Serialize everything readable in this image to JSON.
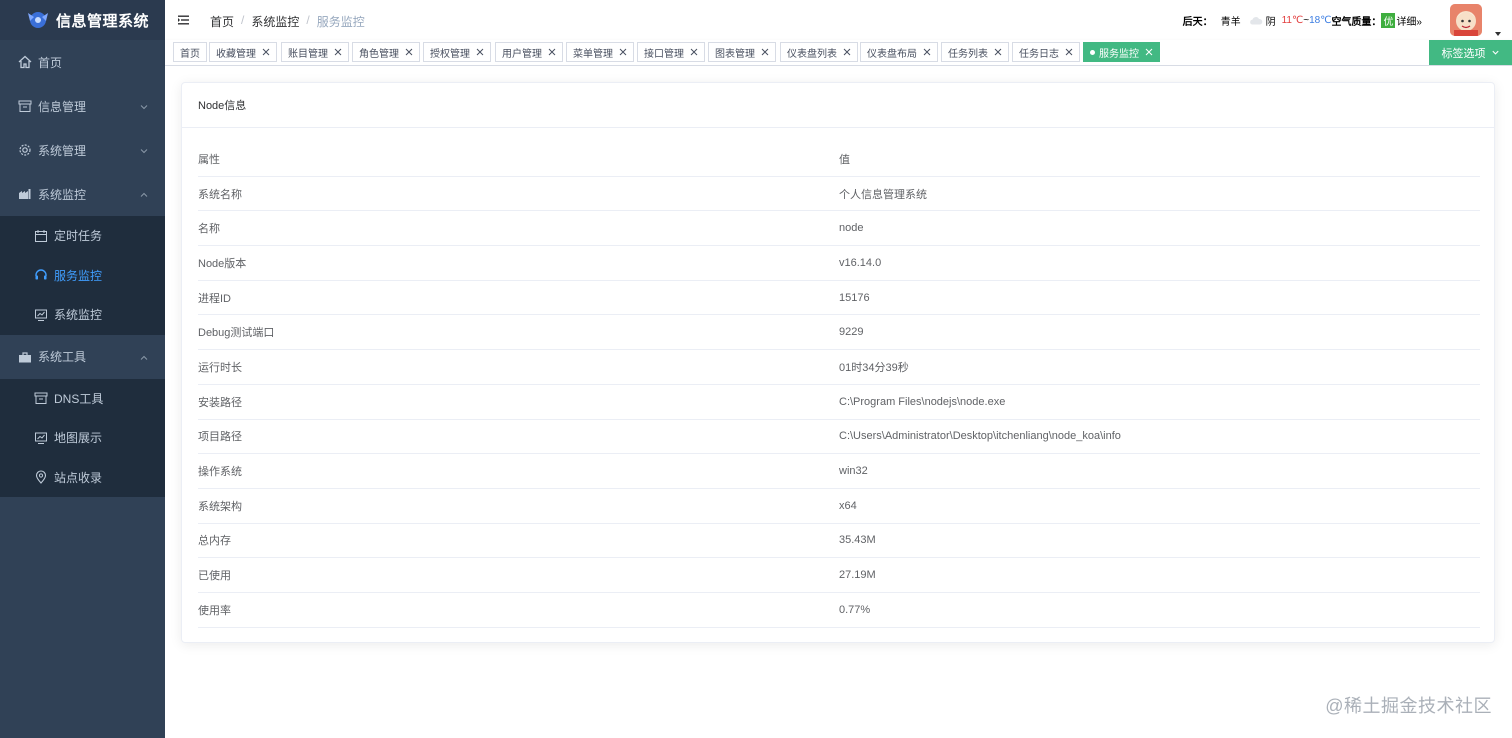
{
  "app": {
    "title": "信息管理系统"
  },
  "sidebar": {
    "items": [
      {
        "label": "首页"
      },
      {
        "label": "信息管理"
      },
      {
        "label": "系统管理"
      },
      {
        "label": "系统监控",
        "children": [
          {
            "label": "定时任务"
          },
          {
            "label": "服务监控"
          },
          {
            "label": "系统监控"
          }
        ]
      },
      {
        "label": "系统工具",
        "children": [
          {
            "label": "DNS工具"
          },
          {
            "label": "地图展示"
          },
          {
            "label": "站点收录"
          }
        ]
      }
    ]
  },
  "header": {
    "breadcrumb": [
      "首页",
      "系统监控",
      "服务监控"
    ],
    "weather": {
      "day": "后天：",
      "city": "青羊",
      "condition": "阴",
      "temp_high": "11℃",
      "tilde": "~",
      "temp_low": "18℃",
      "aq_label": "空气质量：",
      "aq_value": "优",
      "detail": "详细»"
    }
  },
  "tags": {
    "items": [
      "首页",
      "收藏管理",
      "账目管理",
      "角色管理",
      "授权管理",
      "用户管理",
      "菜单管理",
      "接口管理",
      "图表管理",
      "仪表盘列表",
      "仪表盘布局",
      "任务列表",
      "任务日志",
      "服务监控"
    ],
    "options_label": "标签选项"
  },
  "card": {
    "title": "Node信息",
    "columns": [
      "属性",
      "值"
    ],
    "rows": [
      [
        "系统名称",
        "个人信息管理系统"
      ],
      [
        "名称",
        "node"
      ],
      [
        "Node版本",
        "v16.14.0"
      ],
      [
        "进程ID",
        "15176"
      ],
      [
        "Debug测试端口",
        "9229"
      ],
      [
        "运行时长",
        "01时34分39秒"
      ],
      [
        "安装路径",
        "C:\\Program Files\\nodejs\\node.exe"
      ],
      [
        "项目路径",
        "C:\\Users\\Administrator\\Desktop\\itchenliang\\node_koa\\info"
      ],
      [
        "操作系统",
        "win32"
      ],
      [
        "系统架构",
        "x64"
      ],
      [
        "总内存",
        "35.43M"
      ],
      [
        "已使用",
        "27.19M"
      ],
      [
        "使用率",
        "0.77%"
      ]
    ]
  },
  "watermark": "@稀土掘金技术社区",
  "colors": {
    "sidebar_bg": "#304156",
    "submenu_bg": "#1f2d3d",
    "active": "#409eff",
    "tag_active": "#42b983"
  }
}
